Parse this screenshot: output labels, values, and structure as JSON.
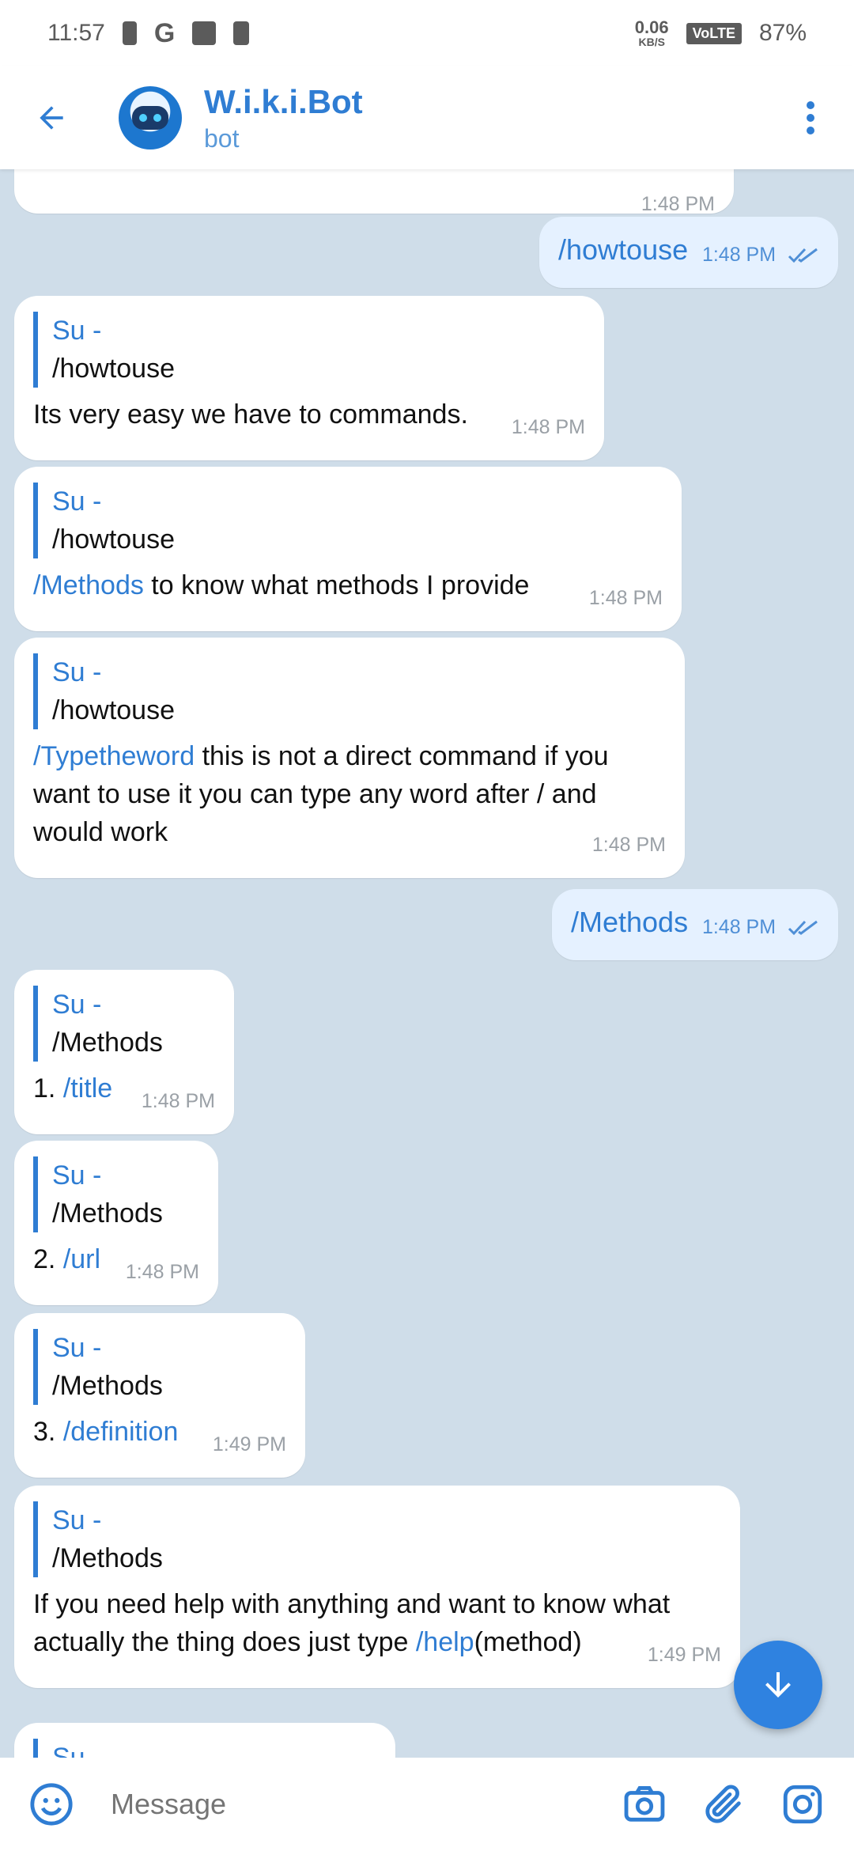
{
  "status": {
    "time": "11:57",
    "net_value": "0.06",
    "net_unit": "KB/S",
    "volte": "VoLTE",
    "battery": "87%"
  },
  "header": {
    "title": "W.i.k.i.Bot",
    "subtitle": "bot"
  },
  "messages": {
    "m0_time": "1:48 PM",
    "m1_text": "/howtouse",
    "m1_time": "1:48 PM",
    "m2_qname": "Su -",
    "m2_qtext": "/howtouse",
    "m2_text": "Its very easy we have to commands.",
    "m2_time": "1:48 PM",
    "m3_qname": "Su -",
    "m3_qtext": "/howtouse",
    "m3_cmd": "/Methods",
    "m3_text": " to know what methods I provide",
    "m3_time": "1:48 PM",
    "m4_qname": "Su -",
    "m4_qtext": "/howtouse",
    "m4_cmd": "/Typetheword",
    "m4_text": " this is not a direct command if you want to use it you can type any word after / and would work",
    "m4_time": "1:48 PM",
    "m5_text": "/Methods",
    "m5_time": "1:48 PM",
    "m6_qname": "Su -",
    "m6_qtext": "/Methods",
    "m6_num": "1. ",
    "m6_cmd": "/title",
    "m6_time": "1:48 PM",
    "m7_qname": "Su -",
    "m7_qtext": "/Methods",
    "m7_num": "2. ",
    "m7_cmd": "/url",
    "m7_time": "1:48 PM",
    "m8_qname": "Su -",
    "m8_qtext": "/Methods",
    "m8_num": "3. ",
    "m8_cmd": "/definition",
    "m8_time": "1:49 PM",
    "m9_qname": "Su -",
    "m9_qtext": "/Methods",
    "m9_text1": "If you need help with anything and want to know what actually the thing does just type ",
    "m9_cmd": "/help",
    "m9_text2": "(method)",
    "m9_time": "1:49 PM",
    "m10_qname": "Su -"
  },
  "input": {
    "placeholder": "Message"
  },
  "colors": {
    "accent": "#2f7dd3",
    "chat_bg": "#cfdde9",
    "outgoing_bubble": "#e5f1ff"
  }
}
